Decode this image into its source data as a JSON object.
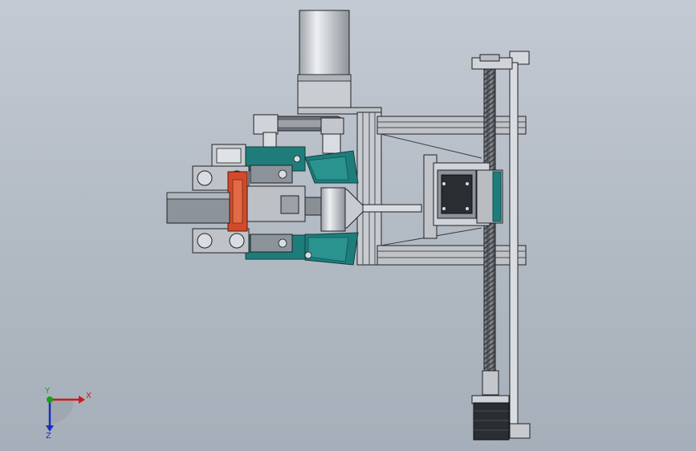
{
  "viewport": {
    "background_top": "#c4cad3",
    "background_bottom": "#a6afb9"
  },
  "model": {
    "colors": {
      "steel_light": "#d9dde2",
      "steel_mid": "#aeb3ba",
      "steel_dark": "#5e646b",
      "line": "#1f2226",
      "teal": "#1e7d7b",
      "teal_dark": "#10504f",
      "red": "#d24a2a",
      "motor_black": "#2a2d31",
      "leadscrew": "#6a6e73"
    }
  },
  "triad": {
    "x_label": "X",
    "y_label": "Y",
    "z_label": "Z",
    "x_color": "#d01818",
    "y_color": "#18a018",
    "z_color": "#1830c0"
  }
}
